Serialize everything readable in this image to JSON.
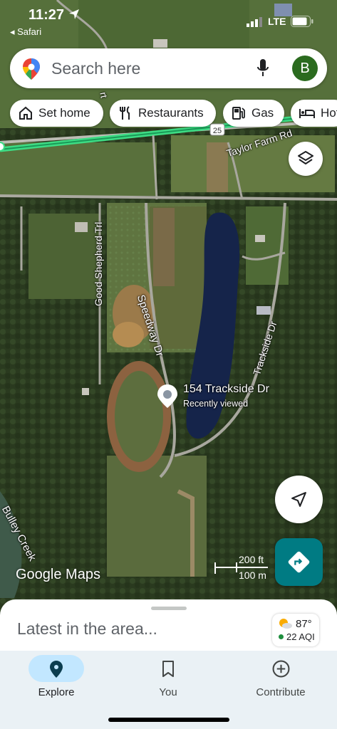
{
  "status_bar": {
    "time": "11:27",
    "back_app": "◂ Safari",
    "network": "LTE"
  },
  "search": {
    "placeholder": "Search here",
    "avatar_initial": "B"
  },
  "chips": [
    {
      "label": "Set home",
      "icon": "home-icon"
    },
    {
      "label": "Restaurants",
      "icon": "fork-knife-icon"
    },
    {
      "label": "Gas",
      "icon": "gas-pump-icon"
    },
    {
      "label": "Hot",
      "icon": "bed-icon"
    }
  ],
  "map": {
    "roads": {
      "highway_shield": "25",
      "taylor_farm": "Taylor Farm Rd",
      "good_shepherd": "Good Shepherd Trl",
      "speedway": "Speedway Dr",
      "trackside": "Trackside Dr",
      "bulley_creek": "Bulley Creek",
      "partial_top": "rt"
    },
    "place": {
      "name": "154 Trackside Dr",
      "subtitle": "Recently viewed"
    },
    "scale": {
      "feet": "200 ft",
      "meters": "100 m"
    },
    "logo": "Google Maps"
  },
  "bottom_sheet": {
    "title": "Latest in the area...",
    "weather": {
      "temp": "87°",
      "aqi": "22 AQI"
    }
  },
  "tabs": [
    {
      "label": "Explore",
      "icon": "location-pin-icon",
      "active": true
    },
    {
      "label": "You",
      "icon": "bookmark-icon",
      "active": false
    },
    {
      "label": "Contribute",
      "icon": "plus-circle-icon",
      "active": false
    }
  ],
  "colors": {
    "accent": "#007b83",
    "highway": "#3ddc84",
    "avatar": "#2b6b1f"
  }
}
